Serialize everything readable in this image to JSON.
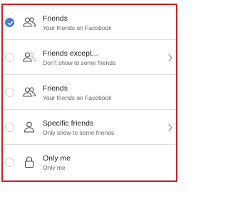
{
  "audience_options": [
    {
      "title": "Friends",
      "subtitle": "Your friends on Facebook",
      "selected": true,
      "icon": "friends-icon",
      "has_chevron": false
    },
    {
      "title": "Friends except...",
      "subtitle": "Don't show to some friends",
      "selected": false,
      "icon": "friends-except-icon",
      "has_chevron": true
    },
    {
      "title": "Friends",
      "subtitle": "Your friends on Facebook",
      "selected": false,
      "icon": "friends-icon",
      "has_chevron": false
    },
    {
      "title": "Specific friends",
      "subtitle": "Only show to some friends",
      "selected": false,
      "icon": "specific-friends-icon",
      "has_chevron": true
    },
    {
      "title": "Only me",
      "subtitle": "Only me",
      "selected": false,
      "icon": "lock-icon",
      "has_chevron": false
    }
  ],
  "colors": {
    "accent": "#4a7bd7",
    "highlight_border": "#c8202a",
    "text_primary": "#1c1e21",
    "text_secondary": "#606770"
  }
}
